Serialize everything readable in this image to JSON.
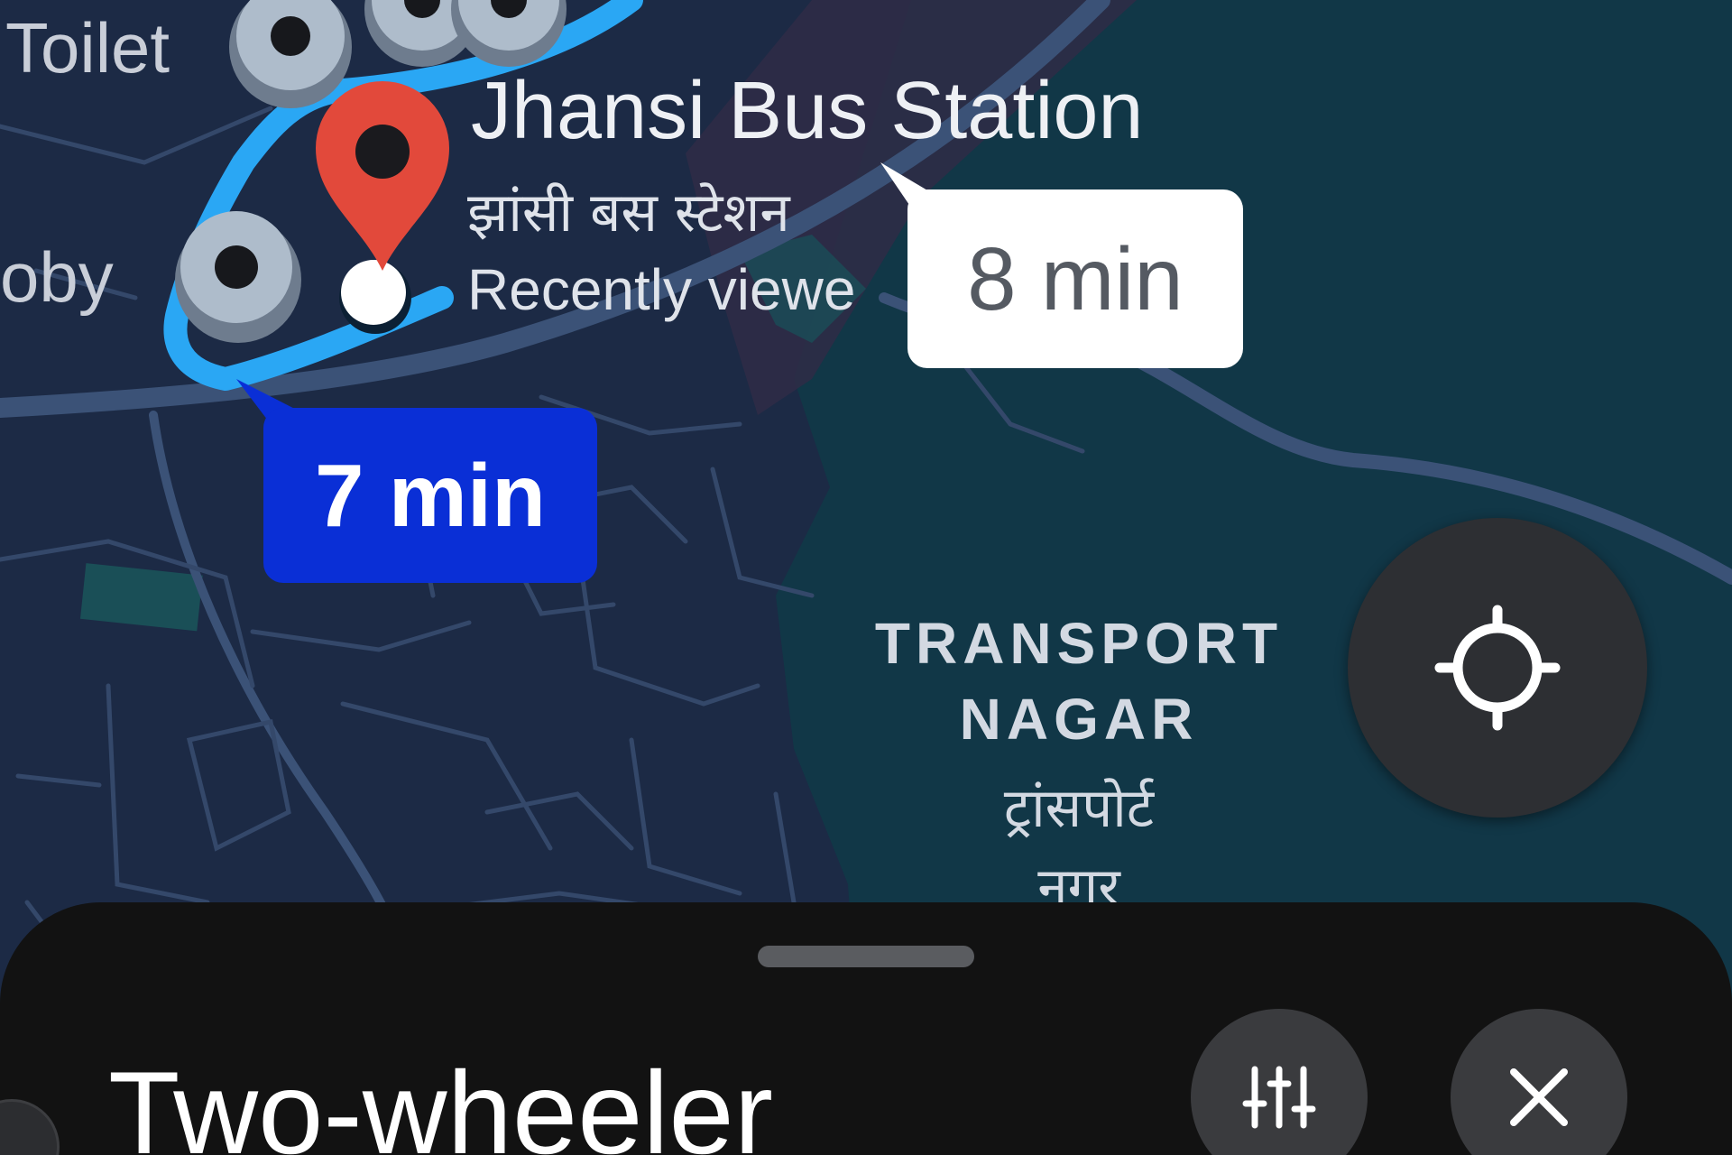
{
  "map": {
    "labels": {
      "toilet": "Toilet",
      "oby": "oby",
      "station_name": "Jhansi Bus Station",
      "station_name_hindi": "झांसी बस स्टेशन",
      "recently_viewed": "Recently viewe",
      "area_line1": "TRANSPORT",
      "area_line2": "NAGAR",
      "area_line3": "ट्रांसपोर्ट",
      "area_line4": "नगर"
    },
    "route_times": {
      "selected": "7 min",
      "alternate": "8 min"
    },
    "colors": {
      "land": "#1c2a45",
      "water": "#113747",
      "route": "#2aa7f4",
      "destination_pin": "#e2493b",
      "selected_route_bubble": "#0a2fd6"
    }
  },
  "controls": {
    "locate_icon": "my-location-icon"
  },
  "sheet": {
    "title": "Two-wheeler",
    "filter_icon": "tune-icon",
    "close_icon": "close-icon"
  }
}
